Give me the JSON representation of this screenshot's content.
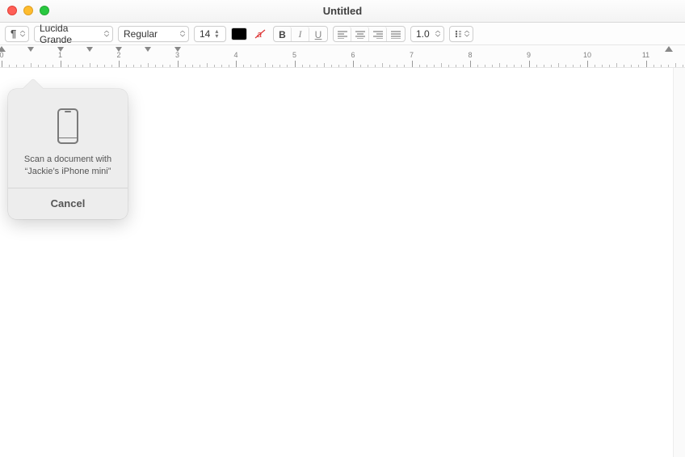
{
  "window": {
    "title": "Untitled"
  },
  "toolbar": {
    "paragraph_symbol": "¶",
    "font_family": "Lucida Grande",
    "font_style": "Regular",
    "font_size": "14",
    "line_height": "1.0",
    "bold": "B",
    "italic": "I",
    "underline": "U"
  },
  "ruler": {
    "labels": [
      "0",
      "1",
      "2",
      "3",
      "4",
      "5",
      "6",
      "7",
      "8",
      "9",
      "10",
      "11"
    ]
  },
  "popover": {
    "line1": "Scan a document with",
    "line2": "“Jackie’s iPhone mini”",
    "cancel": "Cancel"
  }
}
